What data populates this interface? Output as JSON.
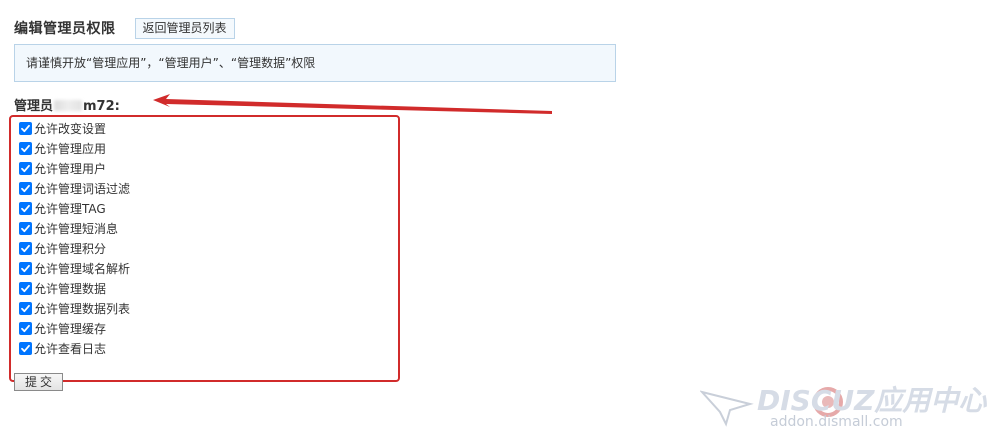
{
  "header": {
    "title": "编辑管理员权限",
    "back_label": "返回管理员列表"
  },
  "notice": {
    "text": "请谨慎开放“管理应用”，“管理用户”、“管理数据”权限"
  },
  "admin": {
    "prefix": "管理员",
    "suffix": "m72:"
  },
  "permissions": [
    {
      "label": "允许改变设置",
      "checked": true
    },
    {
      "label": "允许管理应用",
      "checked": true
    },
    {
      "label": "允许管理用户",
      "checked": true
    },
    {
      "label": "允许管理词语过滤",
      "checked": true
    },
    {
      "label": "允许管理TAG",
      "checked": true
    },
    {
      "label": "允许管理短消息",
      "checked": true
    },
    {
      "label": "允许管理积分",
      "checked": true
    },
    {
      "label": "允许管理域名解析",
      "checked": true
    },
    {
      "label": "允许管理数据",
      "checked": true
    },
    {
      "label": "允许管理数据列表",
      "checked": true
    },
    {
      "label": "允许管理缓存",
      "checked": true
    },
    {
      "label": "允许查看日志",
      "checked": true
    }
  ],
  "form": {
    "submit_label": "提交"
  },
  "watermark": {
    "brand": "DISCUZ应用中心",
    "url": "addon.dismall.com"
  },
  "colors": {
    "accent_red": "#d12b2b",
    "checkbox_blue": "#0075ff",
    "notice_border": "#b9d3e8",
    "notice_bg": "#f2f8fd"
  }
}
